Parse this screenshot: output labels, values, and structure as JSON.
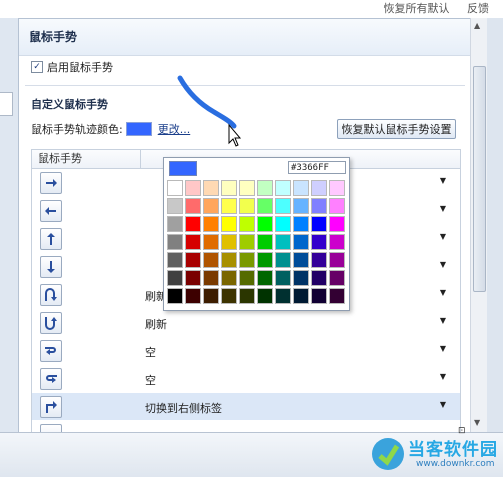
{
  "window": {
    "top_links": [
      "恢复所有默认",
      "反馈"
    ]
  },
  "panel": {
    "title": "鼠标手势",
    "enable_checkbox": {
      "checked": true,
      "label": "启用鼠标手势"
    },
    "custom_section_title": "自定义鼠标手势",
    "trail_color_label": "鼠标手势轨迹颜色:",
    "trail_color": "#3366ff",
    "change_link": "更改...",
    "reset_button": "恢复默认鼠标手势设置",
    "table_header": "鼠标手势",
    "gestures": [
      {
        "icon": "arrow-right-icon",
        "action": "",
        "selected": false
      },
      {
        "icon": "arrow-left-icon",
        "action": "",
        "selected": false
      },
      {
        "icon": "arrow-up-icon",
        "action": "",
        "selected": false
      },
      {
        "icon": "arrow-down-icon",
        "action": "",
        "selected": false
      },
      {
        "icon": "arrow-u-turn-down-icon",
        "action": "刷新",
        "selected": false
      },
      {
        "icon": "arrow-u-turn-up-icon",
        "action": "刷新",
        "selected": false
      },
      {
        "icon": "arrow-return-right-icon",
        "action": "空",
        "selected": false
      },
      {
        "icon": "arrow-return-left-icon",
        "action": "空",
        "selected": false
      },
      {
        "icon": "arrow-up-right-icon",
        "action": "切换到右侧标签",
        "selected": true
      }
    ]
  },
  "color_picker": {
    "current_color": "#3366ff",
    "hex_value": "#3366FF",
    "palette": [
      [
        "#ffffff",
        "#ffc7c7",
        "#ffd9b3",
        "#ffffbf",
        "#ffffc0",
        "#c2ffc2",
        "#c0ffff",
        "#c9e4ff",
        "#cfcfff",
        "#ffc9ff"
      ],
      [
        "#c8c8c8",
        "#ff6b6b",
        "#ffa65c",
        "#ffff4d",
        "#f2ff4d",
        "#66ff66",
        "#4dffff",
        "#66b3ff",
        "#8080ff",
        "#ff80ff"
      ],
      [
        "#a0a0a0",
        "#ff0000",
        "#ff8000",
        "#ffff00",
        "#bfff00",
        "#00ff00",
        "#00ffff",
        "#0080ff",
        "#0000ff",
        "#ff00ff"
      ],
      [
        "#808080",
        "#d60000",
        "#e06c00",
        "#e0c000",
        "#9fcc00",
        "#00cc00",
        "#00bfbf",
        "#0066cc",
        "#3300cc",
        "#cc00cc"
      ],
      [
        "#606060",
        "#a80000",
        "#b05400",
        "#a89000",
        "#7a9900",
        "#009900",
        "#008f8f",
        "#004c99",
        "#330099",
        "#990099"
      ],
      [
        "#404040",
        "#7a0000",
        "#7a3a00",
        "#7a6600",
        "#556b00",
        "#006600",
        "#006060",
        "#003366",
        "#220066",
        "#660066"
      ],
      [
        "#000000",
        "#3d0000",
        "#3d1d00",
        "#3d3300",
        "#2b3600",
        "#003300",
        "#003030",
        "#001a33",
        "#110033",
        "#330033"
      ]
    ]
  },
  "watermark": {
    "title": "当客软件园",
    "url": "www.downkr.com"
  },
  "colors": {
    "panel_header_text": "#1e2f4d",
    "selection": "#dbe7f7",
    "drawn_stroke": "#2a6ee0"
  }
}
